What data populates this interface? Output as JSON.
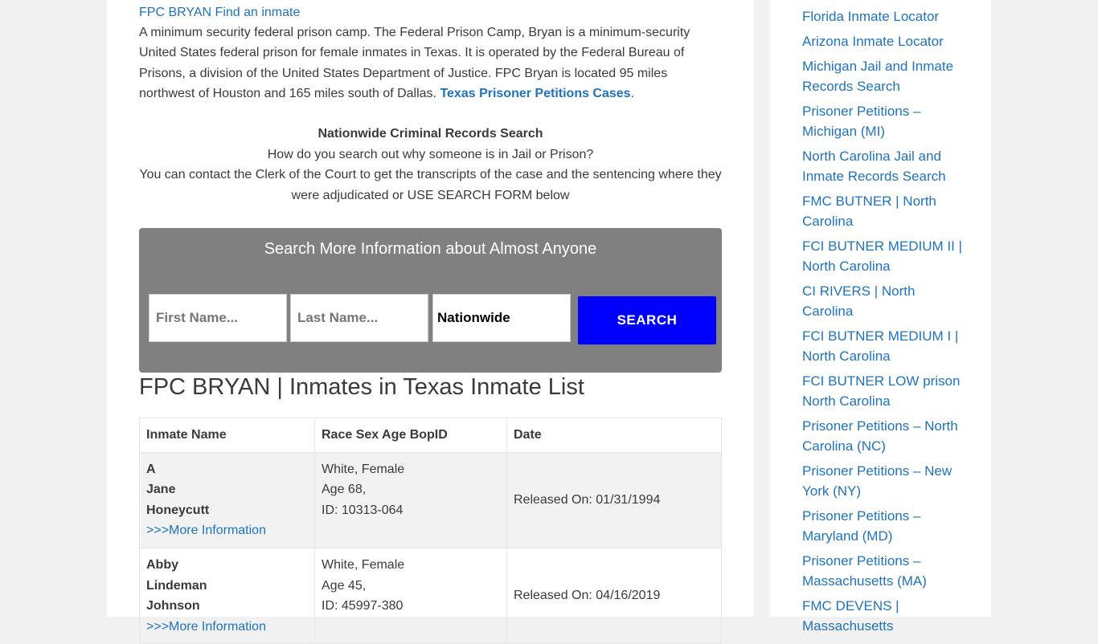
{
  "intro": {
    "link": "FPC BRYAN Find an inmate",
    "text": "A minimum security federal prison camp. The Federal Prison Camp, Bryan is a minimum-security United States federal prison for female inmates in Texas. It is operated by the Federal Bureau of Prisons, a division of the United States Department of Justice. FPC Bryan is located 95 miles northwest of Houston and 165 miles south of Dallas.",
    "strong_link": "Texas Prisoner Petitions Cases",
    "period": "."
  },
  "records": {
    "heading": "Nationwide Criminal Records Search",
    "line1": "How do you search out why someone is in Jail or Prison?",
    "line2": "You can contact the Clerk of the Court to get the transcripts of the case and the sentencing where they were adjudicated or USE SEARCH FORM below"
  },
  "search": {
    "title": "Search More Information about Almost Anyone",
    "first_placeholder": "First Name...",
    "last_placeholder": "Last Name...",
    "state_value": "Nationwide",
    "button": "SEARCH"
  },
  "list_title": "FPC BRYAN | Inmates in Texas Inmate List",
  "table": {
    "headers": [
      "Inmate Name",
      "Race Sex Age BopID",
      "Date"
    ],
    "rows": [
      {
        "first": "A",
        "middle": "Jane",
        "last": "Honeycutt",
        "more": ">>>More Information",
        "race_sex": "White, Female",
        "age": "Age 68,",
        "id": "ID: 10313-064",
        "date": "Released On: 01/31/1994"
      },
      {
        "first": "Abby",
        "middle": "Lindeman",
        "last": "Johnson",
        "more": ">>>More Information",
        "race_sex": "White, Female",
        "age": "Age 45,",
        "id": "ID: 45997-380",
        "date": "Released On: 04/16/2019"
      }
    ]
  },
  "sidebar": {
    "links": [
      "Florida Inmate Locator",
      "Arizona Inmate Locator",
      "Michigan Jail and Inmate Records Search",
      "Prisoner Petitions – Michigan (MI)",
      "North Carolina Jail and Inmate Records Search",
      "FMC BUTNER | North Carolina",
      "FCI BUTNER MEDIUM II | North Carolina",
      "CI RIVERS | North Carolina",
      "FCI BUTNER MEDIUM I | North Carolina",
      "FCI BUTNER LOW prison North Carolina",
      "Prisoner Petitions – North Carolina (NC)",
      "Prisoner Petitions – New York (NY)",
      "Prisoner Petitions – Maryland (MD)",
      "Prisoner Petitions – Massachusetts (MA)",
      "FMC DEVENS | Massachusetts"
    ]
  }
}
